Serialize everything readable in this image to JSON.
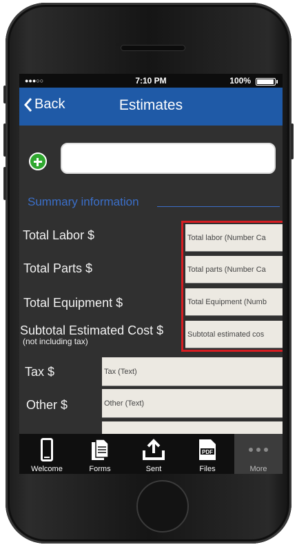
{
  "status_bar": {
    "signal": "●●●○○",
    "time": "7:10 PM",
    "battery": "100%"
  },
  "nav": {
    "back_label": "Back",
    "title": "Estimates"
  },
  "name_input": {
    "value": "",
    "placeholder": ""
  },
  "section_title": "Summary information",
  "rows": [
    {
      "label": "Total Labor $",
      "sublabel": "",
      "field_placeholder": "Total labor (Number Ca"
    },
    {
      "label": "Total Parts $",
      "sublabel": "",
      "field_placeholder": "Total parts (Number Ca"
    },
    {
      "label": "Total Equipment $",
      "sublabel": "",
      "field_placeholder": "Total Equipment (Numb"
    },
    {
      "label": "Subtotal Estimated Cost $",
      "sublabel": "(not including tax)",
      "field_placeholder": "Subtotal estimated cos"
    },
    {
      "label": "Tax $",
      "sublabel": "",
      "field_placeholder": "Tax (Text)"
    },
    {
      "label": "Other $",
      "sublabel": "",
      "field_placeholder": "Other (Text)"
    }
  ],
  "tabs": [
    {
      "label": "Welcome",
      "icon": "phone-icon"
    },
    {
      "label": "Forms",
      "icon": "documents-icon"
    },
    {
      "label": "Sent",
      "icon": "upload-icon"
    },
    {
      "label": "Files",
      "icon": "pdf-icon"
    },
    {
      "label": "More",
      "icon": "more-dots-icon"
    }
  ],
  "colors": {
    "nav_bar": "#1f5aa7",
    "highlight": "#d71d22",
    "section": "#3b6fc9",
    "add_button": "#2fa72f"
  }
}
